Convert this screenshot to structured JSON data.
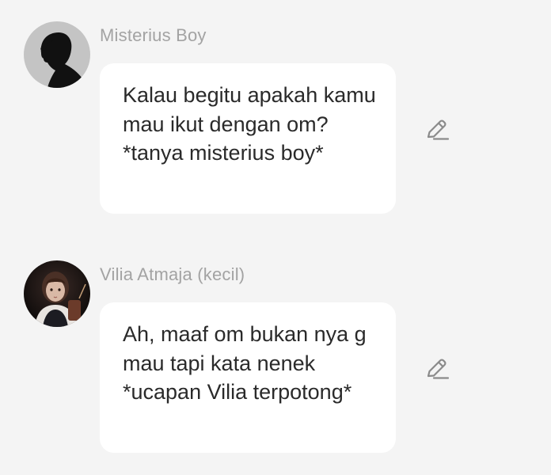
{
  "messages": [
    {
      "sender": "Misterius Boy",
      "avatar_icon": "silhouette-avatar",
      "text": "Kalau begitu apakah kamu mau ikut dengan om? *tanya misterius boy*",
      "edit_icon": "pencil-icon"
    },
    {
      "sender": "Vilia Atmaja (kecil)",
      "avatar_icon": "girl-photo-avatar",
      "text": "Ah, maaf om bukan nya g mau tapi kata nenek *ucapan Vilia terpotong*",
      "edit_icon": "pencil-icon"
    }
  ],
  "colors": {
    "background": "#f4f4f4",
    "bubble": "#ffffff",
    "sender_name": "#a3a3a3",
    "message_text": "#2a2a2a",
    "icon": "#8a8a8a"
  }
}
